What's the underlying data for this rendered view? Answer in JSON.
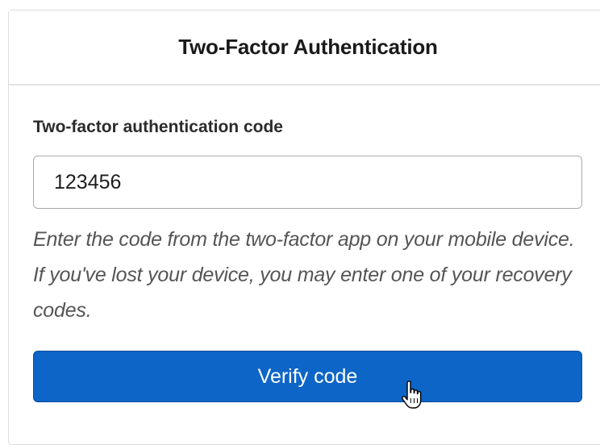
{
  "card": {
    "title": "Two-Factor Authentication"
  },
  "form": {
    "field_label": "Two-factor authentication code",
    "code_value": "123456",
    "help_text": "Enter the code from the two-factor app on your mobile device. If you've lost your device, you may enter one of your recovery codes.",
    "submit_label": "Verify code"
  },
  "colors": {
    "primary_button": "#0d65c7",
    "primary_button_border": "#0a4f9c"
  },
  "icons": {
    "cursor": "hand-pointer-icon"
  }
}
